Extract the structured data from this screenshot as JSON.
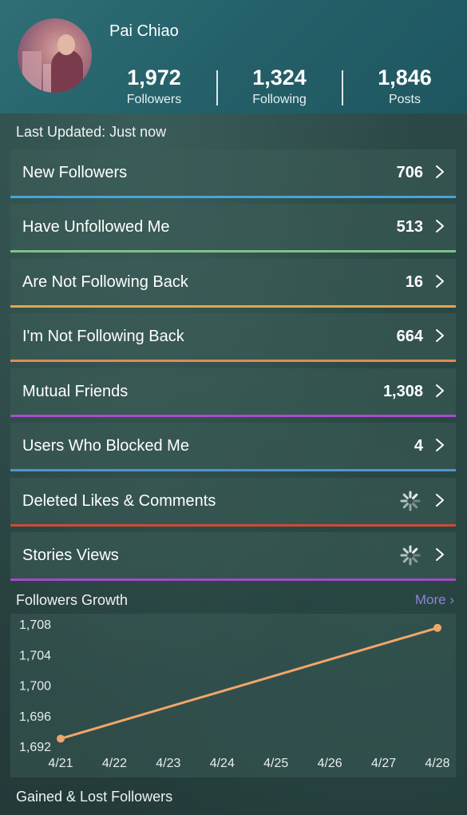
{
  "profile": {
    "name": "Pai Chiao",
    "stats": [
      {
        "value": "1,972",
        "label": "Followers"
      },
      {
        "value": "1,324",
        "label": "Following"
      },
      {
        "value": "1,846",
        "label": "Posts"
      }
    ]
  },
  "last_updated": "Last Updated: Just now",
  "rows": [
    {
      "label": "New Followers",
      "count": "706",
      "color": "#4aa3d6",
      "loading": false
    },
    {
      "label": "Have Unfollowed Me",
      "count": "513",
      "color": "#7ec287",
      "loading": false
    },
    {
      "label": "Are Not Following Back",
      "count": "16",
      "color": "#e3a64a",
      "loading": false
    },
    {
      "label": "I'm Not Following Back",
      "count": "664",
      "color": "#e08a57",
      "loading": false
    },
    {
      "label": "Mutual Friends",
      "count": "1,308",
      "color": "#a64fc9",
      "loading": false
    },
    {
      "label": "Users Who Blocked Me",
      "count": "4",
      "color": "#4f94d0",
      "loading": false
    },
    {
      "label": "Deleted Likes & Comments",
      "count": "",
      "color": "#cf4b34",
      "loading": true
    },
    {
      "label": "Stories Views",
      "count": "",
      "color": "#a449c9",
      "loading": true
    }
  ],
  "growth": {
    "title": "Followers Growth",
    "more": "More ›"
  },
  "gained_lost_title": "Gained & Lost Followers",
  "chart_data": {
    "type": "line",
    "x": [
      "4/21",
      "4/22",
      "4/23",
      "4/24",
      "4/25",
      "4/26",
      "4/27",
      "4/28"
    ],
    "series": [
      {
        "values": [
          1693,
          null,
          null,
          null,
          null,
          null,
          null,
          1707.5
        ],
        "color": "#f0a66a"
      }
    ],
    "y_ticks": [
      "1,708",
      "1,704",
      "1,700",
      "1,696",
      "1,692"
    ],
    "ylim": [
      1692,
      1708
    ],
    "grid": false
  }
}
